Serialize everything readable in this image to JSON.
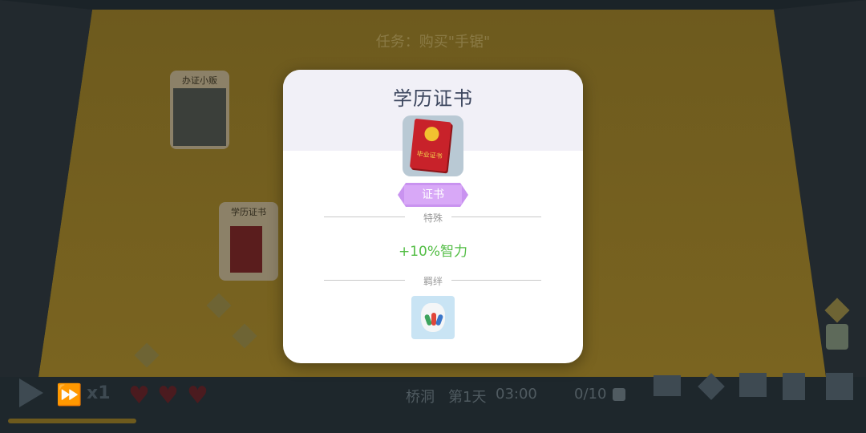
{
  "scene": {
    "task_text": "任务：购买\"手锯\"",
    "cards": [
      {
        "title": "办证小贩"
      },
      {
        "title": "学历证书"
      }
    ],
    "status": {
      "location": "桥洞",
      "day": "第1天",
      "time": "03:00",
      "capacity": "0/10",
      "speed": "x1"
    }
  },
  "modal": {
    "title": "学历证书",
    "item_icon": "certificate-book-icon",
    "book_label": "毕业证书",
    "tag": "证书",
    "special_label": "特殊",
    "special_effect": "+10%智力",
    "bond_label": "羁绊",
    "bond_icon": "money-bag-icon"
  },
  "colors": {
    "effect_green": "#52bd44",
    "tag_purple": "#d8a8f7",
    "title_color": "#3c465e"
  }
}
